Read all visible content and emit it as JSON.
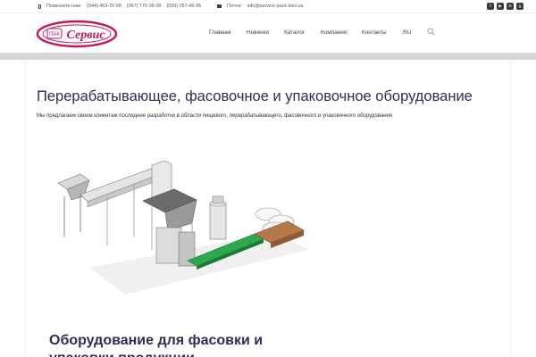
{
  "topbar": {
    "callus_label": "Позвоните нам:",
    "phones": [
      "(044) 463-70-68",
      "(067) 776-38-39",
      "(050) 257-45-35"
    ],
    "mail_label": "Почта:",
    "email": "info@service-pack.kiev.ua",
    "social_icons": [
      "facebook-icon",
      "youtube-icon",
      "rss-icon",
      "google-plus-icon"
    ]
  },
  "header": {
    "logo_small": "ПАК",
    "logo_big": "Сервис",
    "nav": [
      "Главная",
      "Новинки",
      "Каталог",
      "Компания",
      "Контакты",
      "RU"
    ]
  },
  "main": {
    "title": "Перерабатывающее, фасовочное и упаковочное оборудование",
    "intro": "Мы предлагаем своим клиентам последние разработки в области пищевого, перерабатывающего, фасовочного и упаковочного оборудования",
    "section_title": "Оборудование для фасовки и упаковки продукции"
  },
  "colors": {
    "brand": "#c2185b",
    "title": "#2b2f57",
    "belt": "#2ea84a"
  }
}
